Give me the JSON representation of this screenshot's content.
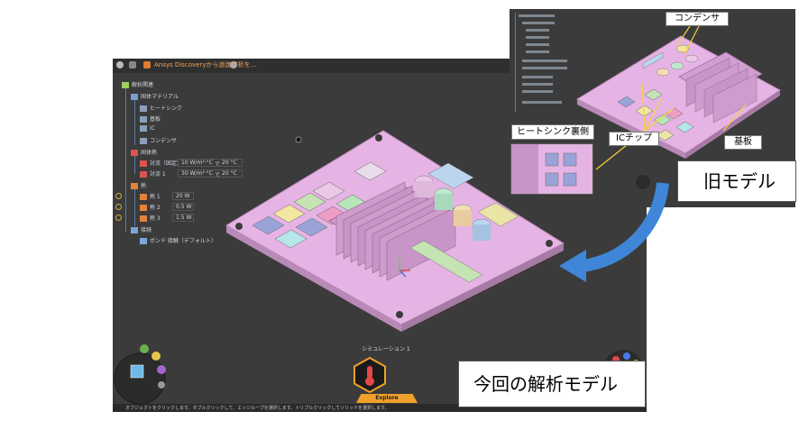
{
  "main_window": {
    "app_title": "Ansys Discoveryから過渡解析を...",
    "tree": {
      "root": "解析関連",
      "material_group": "固体マテリアル",
      "materials": [
        "ヒートシンク",
        "基板",
        "IC",
        "コンデンサ"
      ],
      "fixed_temp_group": "固体熱",
      "fixed_temps": [
        {
          "label": "対流（固定）",
          "value": "10 W/m²·°C",
          "temp_label": "で",
          "temp": "20 °C"
        },
        {
          "label": "対流 1",
          "value": "30 W/m²·°C",
          "temp_label": "で",
          "temp": "20 °C"
        }
      ],
      "heat_group": "熱",
      "heats": [
        {
          "label": "熱 1",
          "value": "20 W"
        },
        {
          "label": "熱 2",
          "value": "0.5 W"
        },
        {
          "label": "熱 3",
          "value": "1.5 W"
        }
      ],
      "contact_group": "接続",
      "contacts": [
        "ボンド 接触（デフォルト）"
      ]
    },
    "simulation_label": "シミュレーション 1",
    "mode_label": "Explore",
    "status_text": "オブジェクトをクリックします。ダブルクリックして、エッジループを選択します。トリプルクリックしてソリッドを選択します。"
  },
  "inset_window": {
    "labels": {
      "capacitor": "コンデンサ",
      "heatsink_back": "ヒートシンク裏側",
      "ic_chip": "ICチップ",
      "substrate": "基板"
    }
  },
  "captions": {
    "old_model": "旧モデル",
    "current_model": "今回の解析モデル"
  },
  "colors": {
    "board": "#e6b4e4",
    "heatsink": "#d9a3d6",
    "explore_accent": "#f0a02a",
    "arrow": "#3f86d8",
    "label_arrow": "#f5d23a"
  }
}
